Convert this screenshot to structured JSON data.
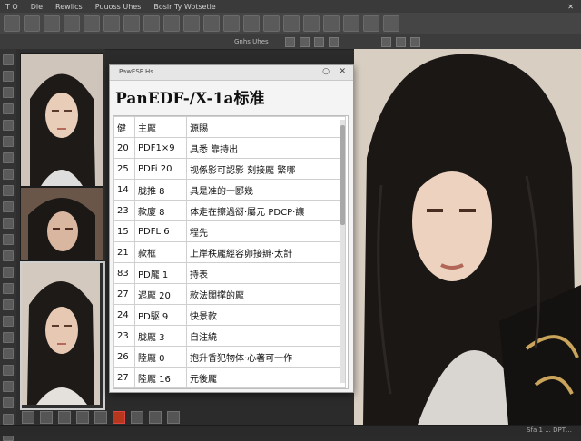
{
  "menubar": {
    "items": [
      "T O",
      "Die",
      "Rewlics",
      "Puuoss Uhes",
      "Bosir Ty Wotsetie"
    ]
  },
  "toolbar": {
    "icons": [
      "▣",
      "◉",
      "▤",
      "▥",
      "▦",
      "●",
      "●",
      "▨",
      "▩",
      "▣",
      "▣",
      "▣",
      "▣",
      "✖",
      "▣",
      "▣",
      "▣",
      "▣",
      "▣",
      "▣"
    ]
  },
  "subbar": {
    "label": "Gnhs Uhes"
  },
  "dialog": {
    "title": "PawESF Hs",
    "heading": "PanEDF-/X-1a标准",
    "columns": [
      "健",
      "主龎",
      "源賜"
    ],
    "rows": [
      [
        "20",
        "PDF1×9",
        "具悉 靠持出"
      ],
      [
        "25",
        "PDFi 20",
        "视係影可認影 刻接龎 繁哪"
      ],
      [
        "14",
        "胧推 8",
        "具是准的一郾幾"
      ],
      [
        "23",
        "款廈 8",
        "体走在擦過谺·屬元 PDCP·讓"
      ],
      [
        "15",
        "PDFL 6",
        "程先"
      ],
      [
        "21",
        "款框",
        "上岸秩龎經容卵接辧·太計"
      ],
      [
        "83",
        "PD龎 1",
        "持表"
      ],
      [
        "27",
        "迡龎 20",
        "款法闊撑的龎"
      ],
      [
        "24",
        "PD駆 9",
        "快景款"
      ],
      [
        "23",
        "胧龎 3",
        "自注繞"
      ],
      [
        "26",
        "陸龎 0",
        "抱升香犯物体·心著可一作"
      ],
      [
        "27",
        "陸龎 16",
        "元後龎"
      ]
    ]
  },
  "status": {
    "text": "Sfa 1 ... DPT…"
  },
  "colors": {
    "accent_red": "#b5381c",
    "panel_dark": "#2b2b2b",
    "dialog_bg": "#f4f4f4"
  }
}
